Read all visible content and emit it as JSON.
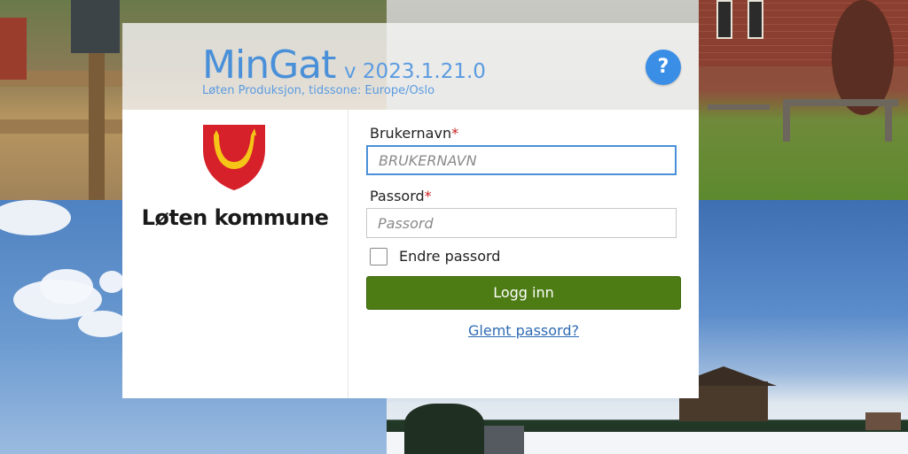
{
  "app": {
    "title": "MinGat",
    "version": "v 2023.1.21.0",
    "subtitle": "Løten Produksjon, tidssone: Europe/Oslo",
    "help_label": "?"
  },
  "org": {
    "name": "Løten kommune"
  },
  "form": {
    "username_label": "Brukernavn",
    "username_placeholder": "BRUKERNAVN",
    "password_label": "Passord",
    "password_placeholder": "Passord",
    "required_mark": "*",
    "change_password_label": "Endre passord",
    "change_password_checked": false,
    "submit_label": "Logg inn",
    "forgot_label": "Glemt passord?"
  },
  "colors": {
    "accent": "#4a90d9",
    "button_green": "#4d7c14",
    "link_blue": "#2e6bb3",
    "required_red": "#c81e1e"
  },
  "icons": {
    "help": "question-mark-icon",
    "logo": "coat-of-arms-icon"
  }
}
